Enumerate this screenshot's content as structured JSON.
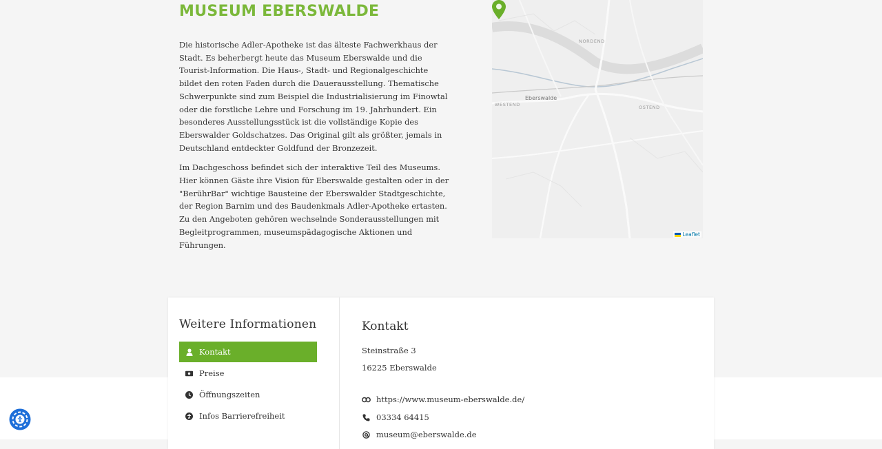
{
  "page": {
    "title": "MUSEUM EBERSWALDE",
    "paragraphs": [
      "Die historische Adler-Apotheke ist das älteste Fachwerkhaus der Stadt. Es beherbergt heute das Museum Eberswalde und die Tourist-Information. Die Haus-, Stadt- und Regionalgeschichte bildet den roten Faden durch die Dauerausstellung. Thematische Schwerpunkte sind zum Beispiel die Industrialisierung im Finowtal oder die forstliche Lehre und Forschung im 19. Jahrhundert. Ein besonderes Ausstellungsstück ist die vollständige Kopie des Eberswalder Goldschatzes. Das Original gilt als größter, jemals in Deutschland entdeckter Goldfund der Bronzezeit.",
      "Im Dachgeschoss befindet sich der interaktive Teil des Museums. Hier können Gäste ihre Vision für Eberswalde gestalten oder in der \"BerührBar\" wichtige Bausteine der Eberswalder Stadtgeschichte, der Region Barnim und des Baudenkmals Adler-Apotheke ertasten. Zu den Angeboten gehören wechselnde Sonderausstellungen mit Begleitprogrammen, museumspädagogische Aktionen und Führungen."
    ]
  },
  "map": {
    "labels": {
      "nordend": "NORDEND",
      "westend": "WESTEND",
      "city": "Eberswalde",
      "ostend": "OSTEND"
    },
    "attribution": "Leaflet",
    "pin_color": "#6aaf2a"
  },
  "info": {
    "heading": "Weitere Informationen",
    "nav": [
      {
        "label": "Kontakt",
        "icon": "person-icon",
        "active": true
      },
      {
        "label": "Preise",
        "icon": "money-icon",
        "active": false
      },
      {
        "label": "Öffnungszeiten",
        "icon": "clock-icon",
        "active": false
      },
      {
        "label": "Infos Barrierefreiheit",
        "icon": "accessibility-icon",
        "active": false
      }
    ]
  },
  "contact": {
    "heading": "Kontakt",
    "street": "Steinstraße 3",
    "city": "16225 Eberswalde",
    "website": "https://www.museum-eberswalde.de/",
    "phone": "03334 64415",
    "email": "museum@eberswalde.de"
  },
  "colors": {
    "accent": "#7bb83a",
    "active_nav": "#6aaf2a",
    "accessibility_button": "#1e6fd9"
  }
}
